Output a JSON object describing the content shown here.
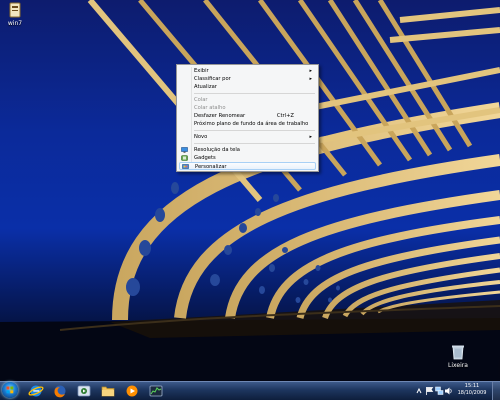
{
  "desktop": {
    "icons": [
      {
        "label": "win7",
        "name": "desktop-icon-win7"
      },
      {
        "label": "Lixeira",
        "name": "desktop-icon-lixeira"
      }
    ]
  },
  "context_menu": {
    "items": [
      {
        "label": "Exibir",
        "submenu": true
      },
      {
        "label": "Classificar por",
        "submenu": true
      },
      {
        "label": "Atualizar"
      },
      {
        "label": "Colar",
        "disabled": true
      },
      {
        "label": "Colar atalho",
        "disabled": true
      },
      {
        "label": "Desfazer Renomear",
        "shortcut": "Ctrl+Z"
      },
      {
        "label": "Próximo plano de fundo da área de trabalho"
      },
      {
        "label": "Novo",
        "submenu": true
      },
      {
        "label": "Resolução da tela"
      },
      {
        "label": "Gadgets"
      },
      {
        "label": "Personalizar",
        "highlighted": true
      }
    ],
    "arrow": "▸"
  },
  "taskbar": {
    "pinned": [
      "start-button",
      "internet-explorer",
      "firefox",
      "media-center",
      "windows-explorer",
      "windows-media-player",
      "task-manager"
    ],
    "clock": {
      "time": "15:11",
      "date": "18/10/2009"
    }
  }
}
